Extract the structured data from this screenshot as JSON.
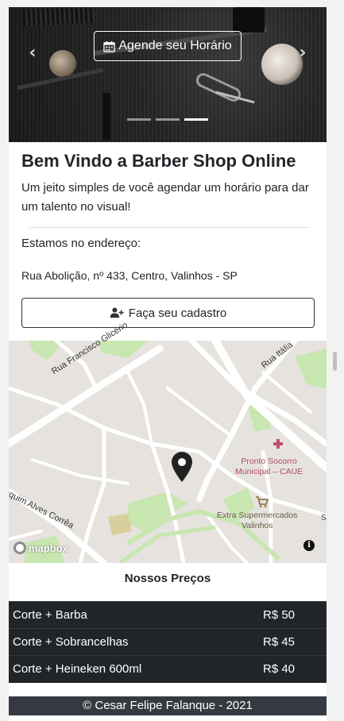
{
  "carousel": {
    "cta_label": "Agende seu Horário",
    "prev_glyph": "‹",
    "next_glyph": "›",
    "indicators": 3,
    "active_indicator": 3
  },
  "welcome": {
    "title": "Bem Vindo a Barber Shop Online",
    "text": "Um jeito simples de você agendar um horário para dar um talento no visual!"
  },
  "location": {
    "label": "Estamos no endereço:",
    "address": "Rua Abolição, nº 433, Centro, Valinhos - SP"
  },
  "register_button": {
    "label": "Faça seu cadastro"
  },
  "map": {
    "streets": [
      "Rua Francisco Glicério",
      "Rua Itália",
      "aquim Alves Corrêa"
    ],
    "poi_hospital": [
      "Pronto Socorro",
      "Municipal – CAUE"
    ],
    "poi_market": [
      "Extra Supermercados",
      "Valinhos"
    ],
    "edge_char": "S",
    "attribution": "mapbox",
    "info_glyph": "i"
  },
  "prices": {
    "title": "Nossos Preços",
    "rows": [
      {
        "service": "Corte + Barba",
        "price": "R$ 50"
      },
      {
        "service": "Corte + Sobrancelhas",
        "price": "R$ 45"
      },
      {
        "service": "Corte + Heineken 600ml",
        "price": "R$ 40"
      }
    ]
  },
  "footer": {
    "text": "© Cesar Felipe Falanque - 2021"
  },
  "colors": {
    "dark": "#212529",
    "footer": "#343a40",
    "map_green": "#c8e6b0",
    "pin": "#222222"
  }
}
